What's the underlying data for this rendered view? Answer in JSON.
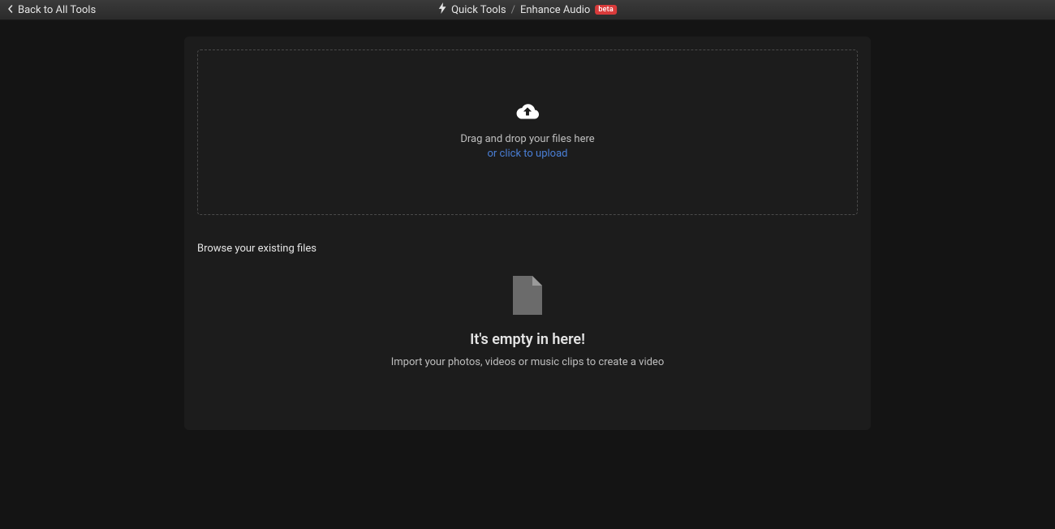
{
  "header": {
    "back_label": "Back to All Tools",
    "breadcrumb": {
      "root": "Quick Tools",
      "separator": "/",
      "current": "Enhance Audio",
      "badge": "beta"
    }
  },
  "dropzone": {
    "line1": "Drag and drop your files here",
    "line2": "or click to upload"
  },
  "browse": {
    "label": "Browse your existing files"
  },
  "empty_state": {
    "title": "It's empty in here!",
    "subtitle": "Import your photos, videos or music clips to create a video"
  }
}
